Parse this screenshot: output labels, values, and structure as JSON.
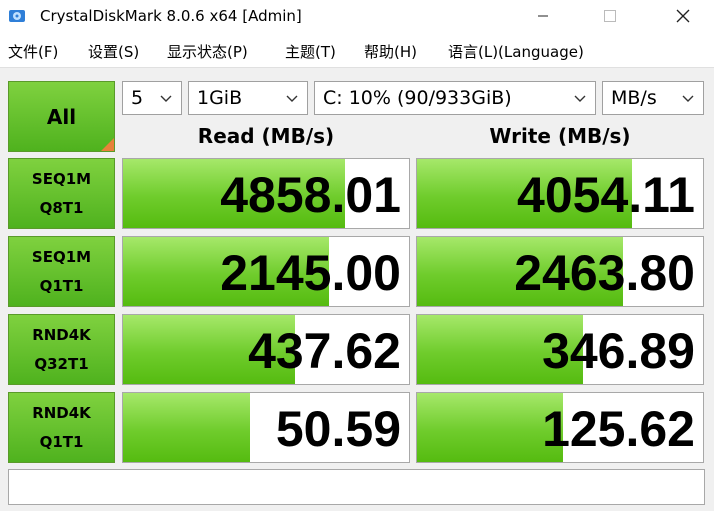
{
  "window": {
    "title": "CrystalDiskMark 8.0.6 x64 [Admin]",
    "controls": {
      "minimize": "—",
      "maximize": "☐",
      "close": "✕"
    }
  },
  "menu": {
    "items": [
      "文件(F)",
      "设置(S)",
      "显示状态(P)",
      "主题(T)",
      "帮助(H)",
      "语言(L)(Language)"
    ]
  },
  "controls": {
    "all_label": "All",
    "count": "5",
    "size": "1GiB",
    "drive": "C: 10% (90/933GiB)",
    "unit": "MB/s"
  },
  "headers": {
    "read": "Read (MB/s)",
    "write": "Write (MB/s)"
  },
  "tests": [
    {
      "line1": "SEQ1M",
      "line2": "Q8T1",
      "read": "4858.01",
      "write": "4054.11",
      "read_fill": 0.775,
      "write_fill": 0.75
    },
    {
      "line1": "SEQ1M",
      "line2": "Q1T1",
      "read": "2145.00",
      "write": "2463.80",
      "read_fill": 0.72,
      "write_fill": 0.72
    },
    {
      "line1": "RND4K",
      "line2": "Q32T1",
      "read": "437.62",
      "write": "346.89",
      "read_fill": 0.6,
      "write_fill": 0.58
    },
    {
      "line1": "RND4K",
      "line2": "Q1T1",
      "read": "50.59",
      "write": "125.62",
      "read_fill": 0.445,
      "write_fill": 0.51
    }
  ],
  "comment": "",
  "colors": {
    "button_green": "#4fb21e",
    "bar_green": "#6fcc2c",
    "corner_orange": "#e8813a"
  }
}
